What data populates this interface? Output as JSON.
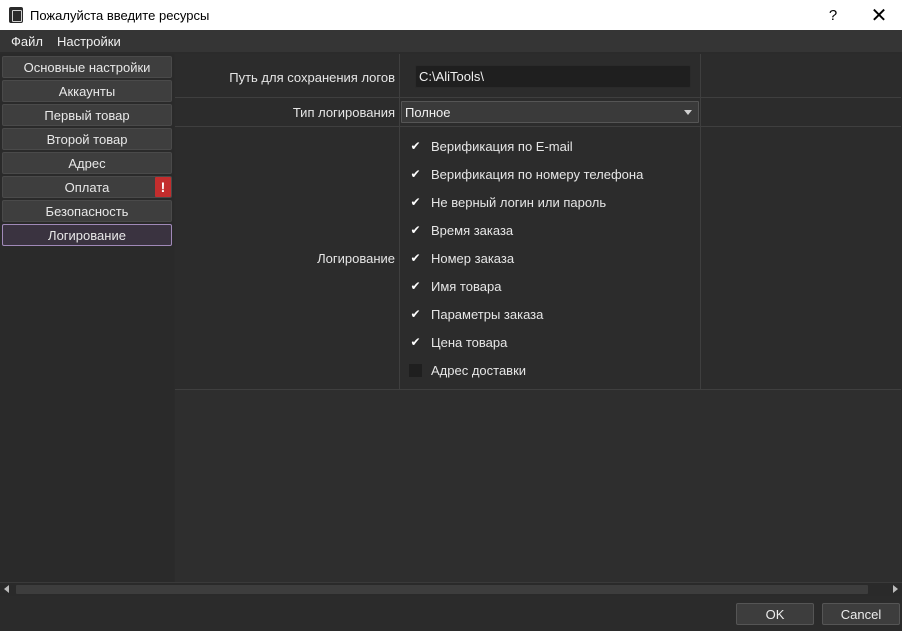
{
  "window": {
    "title": "Пожалуйста введите ресурсы",
    "help": "?",
    "close": "✕"
  },
  "menubar": {
    "items": [
      "Файл",
      "Настройки"
    ]
  },
  "sidebar": {
    "items": [
      {
        "label": "Основные настройки"
      },
      {
        "label": "Аккаунты"
      },
      {
        "label": "Первый товар"
      },
      {
        "label": "Второй товар"
      },
      {
        "label": "Адрес"
      },
      {
        "label": "Оплата",
        "badge": "!"
      },
      {
        "label": "Безопасность"
      },
      {
        "label": "Логирование",
        "active": true
      }
    ]
  },
  "form": {
    "path_label": "Путь для сохранения логов",
    "path_value": "C:\\AliTools\\",
    "type_label": "Тип логирования",
    "type_value": "Полное",
    "logging_label": "Логирование",
    "options": [
      {
        "label": "Верификация по E-mail",
        "checked": true
      },
      {
        "label": "Верификация по номеру телефона",
        "checked": true
      },
      {
        "label": "Не верный логин или пароль",
        "checked": true
      },
      {
        "label": "Время заказа",
        "checked": true
      },
      {
        "label": "Номер заказа",
        "checked": true
      },
      {
        "label": "Имя товара",
        "checked": true
      },
      {
        "label": "Параметры заказа",
        "checked": true
      },
      {
        "label": "Цена товара",
        "checked": true
      },
      {
        "label": "Адрес доставки",
        "checked": false
      }
    ]
  },
  "footer": {
    "ok_label": "OK",
    "cancel_label": "Cancel"
  },
  "icons": {
    "check": "✔",
    "warning_color": "#c32d2d",
    "active_border_color": "#a089b8"
  }
}
